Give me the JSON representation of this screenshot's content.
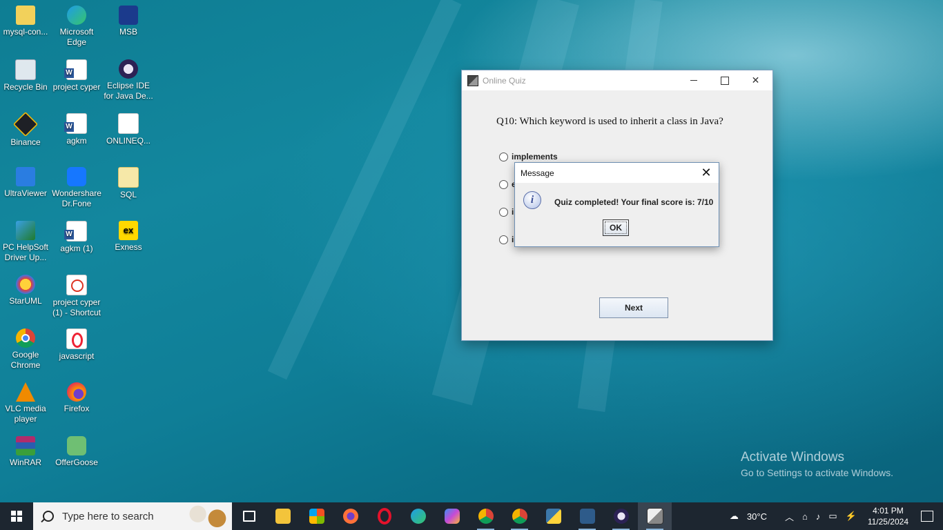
{
  "desktop_icons": [
    {
      "label": "mysql-con...",
      "icon": "folder-icon"
    },
    {
      "label": "Microsoft Edge",
      "icon": "edge-icon"
    },
    {
      "label": "MSB",
      "icon": "msb-icon"
    },
    {
      "label": "Recycle Bin",
      "icon": "recycle-bin-icon"
    },
    {
      "label": "project cyper",
      "icon": "word-doc-icon"
    },
    {
      "label": "Eclipse IDE for Java De...",
      "icon": "eclipse-icon"
    },
    {
      "label": "Binance",
      "icon": "binance-icon"
    },
    {
      "label": "agkm",
      "icon": "word-doc-icon"
    },
    {
      "label": "ONLINEQ...",
      "icon": "java-file-icon"
    },
    {
      "label": "UltraViewer",
      "icon": "ultraviewer-icon"
    },
    {
      "label": "Wondershare Dr.Fone",
      "icon": "drfone-icon"
    },
    {
      "label": "SQL",
      "icon": "folder-icon"
    },
    {
      "label": "PC HelpSoft Driver Up...",
      "icon": "pc-helpsoft-icon"
    },
    {
      "label": "agkm (1)",
      "icon": "word-doc-icon"
    },
    {
      "label": "Exness",
      "icon": "exness-icon"
    },
    {
      "label": "StarUML",
      "icon": "staruml-icon"
    },
    {
      "label": "project cyper (1) - Shortcut",
      "icon": "pdf-icon"
    },
    {
      "label": "Google Chrome",
      "icon": "chrome-icon"
    },
    {
      "label": "javascript",
      "icon": "opera-file-icon"
    },
    {
      "label": "VLC media player",
      "icon": "vlc-icon"
    },
    {
      "label": "Firefox",
      "icon": "firefox-icon"
    },
    {
      "label": "WinRAR",
      "icon": "winrar-icon"
    },
    {
      "label": "OfferGoose",
      "icon": "offergoose-icon"
    }
  ],
  "quiz_window": {
    "title": "Online Quiz",
    "question": "Q10: Which keyword is used to inherit a class in Java?",
    "options": [
      "implements",
      "e",
      "in",
      "in"
    ],
    "next_label": "Next"
  },
  "message_dialog": {
    "title": "Message",
    "icon": "info-icon",
    "message": "Quiz completed! Your final score is: 7/10",
    "ok_label": "OK"
  },
  "watermark": {
    "line1": "Activate Windows",
    "line2": "Go to Settings to activate Windows."
  },
  "taskbar": {
    "search_placeholder": "Type here to search",
    "weather": "30°C",
    "time": "4:01 PM",
    "date": "11/25/2024",
    "apps": [
      "task-view",
      "file-explorer",
      "microsoft-store",
      "firefox",
      "opera",
      "edge",
      "copilot",
      "chrome-1",
      "chrome-2",
      "python",
      "mysql-workbench",
      "eclipse",
      "java-app"
    ]
  }
}
